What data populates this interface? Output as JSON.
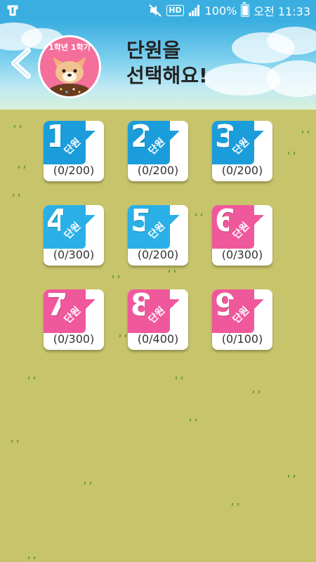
{
  "statusbar": {
    "battery_percent": "100%",
    "time": "오전 11:33",
    "hd_label": "HD"
  },
  "header": {
    "avatar_label": "1학년 1학기",
    "title_line1": "단원을",
    "title_line2": "선택해요!"
  },
  "units": [
    {
      "number": "1",
      "unit_label": "단원",
      "progress": "(0/200)",
      "color": "#1c9ddb"
    },
    {
      "number": "2",
      "unit_label": "단원",
      "progress": "(0/200)",
      "color": "#1c9ddb"
    },
    {
      "number": "3",
      "unit_label": "단원",
      "progress": "(0/200)",
      "color": "#1c9ddb"
    },
    {
      "number": "4",
      "unit_label": "단원",
      "progress": "(0/300)",
      "color": "#2ab0e6"
    },
    {
      "number": "5",
      "unit_label": "단원",
      "progress": "(0/200)",
      "color": "#2ab0e6"
    },
    {
      "number": "6",
      "unit_label": "단원",
      "progress": "(0/300)",
      "color": "#f0589c"
    },
    {
      "number": "7",
      "unit_label": "단원",
      "progress": "(0/300)",
      "color": "#f0589c"
    },
    {
      "number": "8",
      "unit_label": "단원",
      "progress": "(0/400)",
      "color": "#f0589c"
    },
    {
      "number": "9",
      "unit_label": "단원",
      "progress": "(0/100)",
      "color": "#f0589c"
    }
  ]
}
